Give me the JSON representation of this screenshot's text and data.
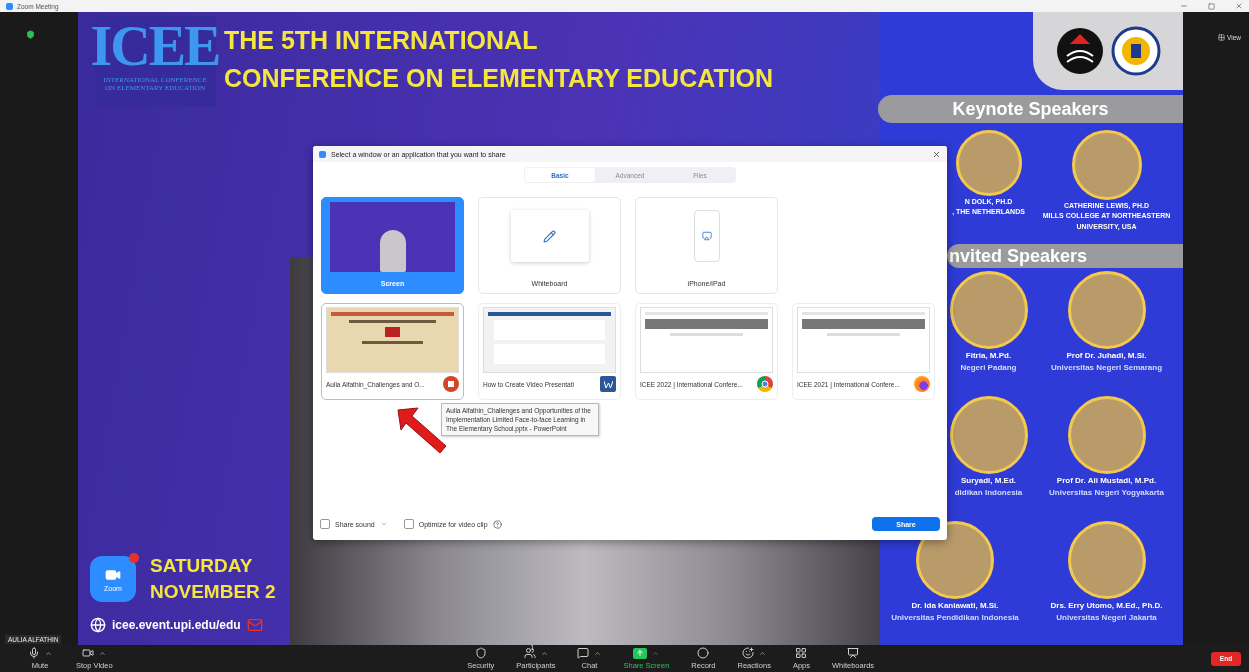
{
  "window": {
    "title": "Zoom Meeting"
  },
  "meeting": {
    "view_label": "View",
    "participant_name": "AULIA ALFATHIN"
  },
  "slide": {
    "logo": {
      "mark": "ICEE",
      "subtitle_lines": [
        "INTERNATIONAL CONFERENCE",
        "ON ELEMENTARY EDUCATION"
      ]
    },
    "title_lines": [
      "THE 5TH INTERNATIONAL",
      "CONFERENCE ON ELEMENTARY EDUCATION"
    ],
    "zoom_badge": "Zoom",
    "date_lines": [
      "SATURDAY",
      "NOVEMBER 2"
    ],
    "url": "icee.event.upi.edu/edu",
    "keynote_heading": "Keynote Speakers",
    "keynote_speakers": [
      {
        "lines": [
          "N DOLK, PH.D",
          ", THE NETHERLANDS"
        ]
      },
      {
        "lines": [
          "CATHERINE LEWIS, PH.D",
          "MILLS COLLEGE AT NORTHEASTERN",
          "UNIVERSITY, USA"
        ]
      }
    ],
    "invited_heading": "nvited Speakers",
    "invited_speakers": [
      {
        "name": "Fitria, M.Pd.",
        "affiliation": "Negeri Padang"
      },
      {
        "name": "Prof Dr. Juhadi, M.Si.",
        "affiliation": "Universitas Negeri Semarang"
      },
      {
        "name": "Suryadi, M.Ed.",
        "affiliation": "didikan Indonesia"
      },
      {
        "name": "Prof Dr. Ali Mustadi, M.Pd.",
        "affiliation": "Universitas Negeri Yogyakarta"
      },
      {
        "name": "Dr. Ida Kaniawati, M.Si.",
        "affiliation": "Universitas Pendidikan Indonesia"
      },
      {
        "name": "Drs. Erry Utomo, M.Ed., Ph.D.",
        "affiliation": "Universitas Negeri Jakarta"
      }
    ]
  },
  "share_dialog": {
    "title": "Select a window or an application that you want to share",
    "tabs": [
      {
        "label": "Basic",
        "selected": true
      },
      {
        "label": "Advanced",
        "selected": false
      },
      {
        "label": "Files",
        "selected": false
      }
    ],
    "sources": [
      {
        "kind": "screen",
        "label": "Screen",
        "selected": true
      },
      {
        "kind": "whiteboard",
        "label": "Whiteboard",
        "selected": false
      },
      {
        "kind": "phone",
        "label": "iPhone/iPad",
        "selected": false
      }
    ],
    "windows": [
      {
        "kind": "powerpoint",
        "title": "Aulia Alfathin_Challenges and O...",
        "hovered": true
      },
      {
        "kind": "word",
        "title": "How to Create Video Presentati",
        "hovered": false
      },
      {
        "kind": "chrome",
        "title": "ICEE 2022 | International Confere...",
        "hovered": false
      },
      {
        "kind": "firefox",
        "title": "ICEE 2021 | International Confere...",
        "hovered": false
      }
    ],
    "tooltip": "Aulia Alfathin_Challenges and Opportunities of the Implementation Limited Face-to-face Learning in The Elementary School.pptx - PowerPoint",
    "options": [
      {
        "kind": "dropdown",
        "label": "Share sound",
        "checked": false
      },
      {
        "kind": "help",
        "label": "Optimize for video clip",
        "checked": false
      }
    ],
    "share_button": "Share"
  },
  "toolbar": {
    "items": [
      {
        "kind": "mic",
        "label": "Mute",
        "caret": true
      },
      {
        "kind": "video",
        "label": "Stop Video",
        "caret": true
      },
      {
        "kind": "security",
        "label": "Security",
        "caret": false
      },
      {
        "kind": "participants",
        "label": "Participants",
        "caret": true,
        "badge": "1"
      },
      {
        "kind": "chat",
        "label": "Chat",
        "caret": true
      },
      {
        "kind": "share",
        "label": "Share Screen",
        "caret": true
      },
      {
        "kind": "record",
        "label": "Record",
        "caret": false
      },
      {
        "kind": "reactions",
        "label": "Reactions",
        "caret": true
      },
      {
        "kind": "apps",
        "label": "Apps",
        "caret": false
      },
      {
        "kind": "whiteboard",
        "label": "Whiteboards",
        "caret": false
      }
    ],
    "end_button": "End"
  }
}
